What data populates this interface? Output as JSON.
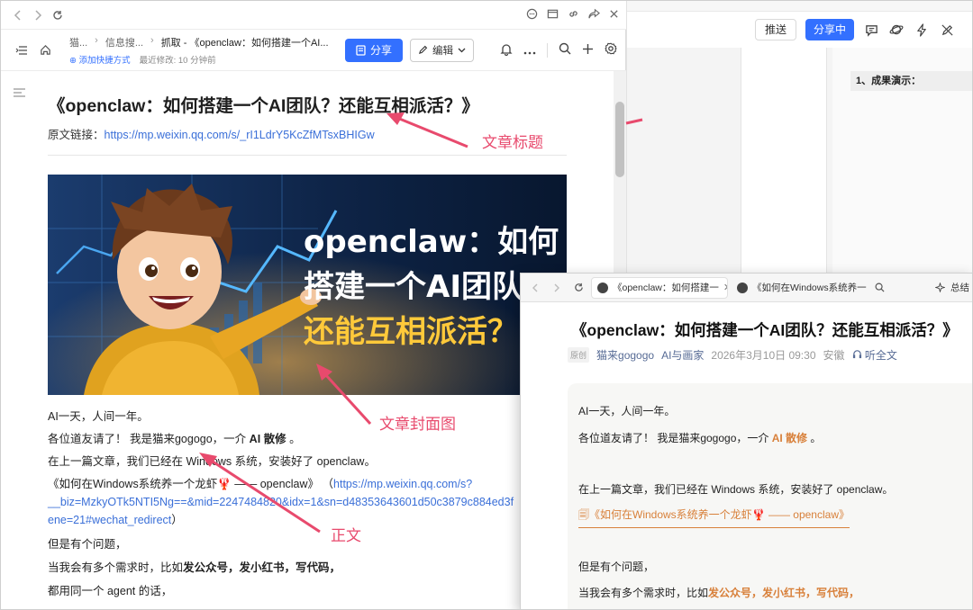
{
  "right_window": {
    "push_label": "推送",
    "sharing_label": "分享中",
    "section_heading": "1、成果演示："
  },
  "main_window": {
    "breadcrumb": [
      "猫...",
      "信息搜...",
      "抓取 - 《openclaw：如何搭建一个AI..."
    ],
    "add_shortcut": "添加快捷方式",
    "last_modified": "最近修改: 10 分钟前",
    "share_label": "分享",
    "edit_label": "编辑",
    "doc": {
      "title": "《openclaw：如何搭建一个AI团队？还能互相派活？》",
      "source_label": "原文链接：",
      "source_url": "https://mp.weixin.qq.com/s/_rI1LdrY5KcZfMTsxBHIGw",
      "cover_text": [
        "openclaw：如何",
        "搭建一个AI团队？",
        "还能互相派活？"
      ],
      "body": {
        "p1": "AI一天，人间一年。",
        "p2_before": "各位道友请了！ 我是猫来gogogo，一介 ",
        "p2_bold": "AI 散修",
        "p2_after": " 。",
        "p3": "在上一篇文章，我们已经在 Windows 系统，安装好了 openclaw。",
        "p4_text": "《如何在Windows系统养一个龙虾🦞 —— openclaw》 （",
        "p4_link1": "https://mp.weixin.qq.com/s?",
        "p4_link2": "__biz=MzkyOTk5NTI5Ng==&mid=2247484820&idx=1&sn=d48353643601d50c3879c884ed3f",
        "p4_link3": "ene=21#wechat_redirect",
        "p4_close": "）",
        "p5": "但是有个问题，",
        "p6_before": "当我会有多个需求时，比如",
        "p6_bold": "发公众号，发小红书，写代码，",
        "p7": "都用同一个 agent 的话，"
      }
    }
  },
  "overlay_window": {
    "tab_active": "《openclaw：如何搭建一",
    "tab_inactive": "《如何在Windows系统养一个",
    "summary_label": "总结",
    "title": "《openclaw：如何搭建一个AI团队？还能互相派活？》",
    "original_badge": "原创",
    "author": "猫来gogogo",
    "account": "AI与画家",
    "date": "2026年3月10日 09:30",
    "location": "安徽",
    "listen": "听全文",
    "body": {
      "p1": "AI一天，人间一年。",
      "p2_before": "各位道友请了！ 我是猫来gogogo，一介 ",
      "p2_bold": "AI 散修",
      "p2_after": " 。",
      "p3": "在上一篇文章，我们已经在 Windows 系统，安装好了 openclaw。",
      "p4_link": "🗐《如何在Windows系统养一个龙虾🦞 —— openclaw》",
      "p5": "但是有个问题，",
      "p6_before": "当我会有多个需求时，比如",
      "p6_bold": "发公众号，发小红书，写代码，"
    }
  },
  "annotations": {
    "title_label": "文章标题",
    "cover_label": "文章封面图",
    "body_label": "正文",
    "color": "#e84a6d"
  }
}
